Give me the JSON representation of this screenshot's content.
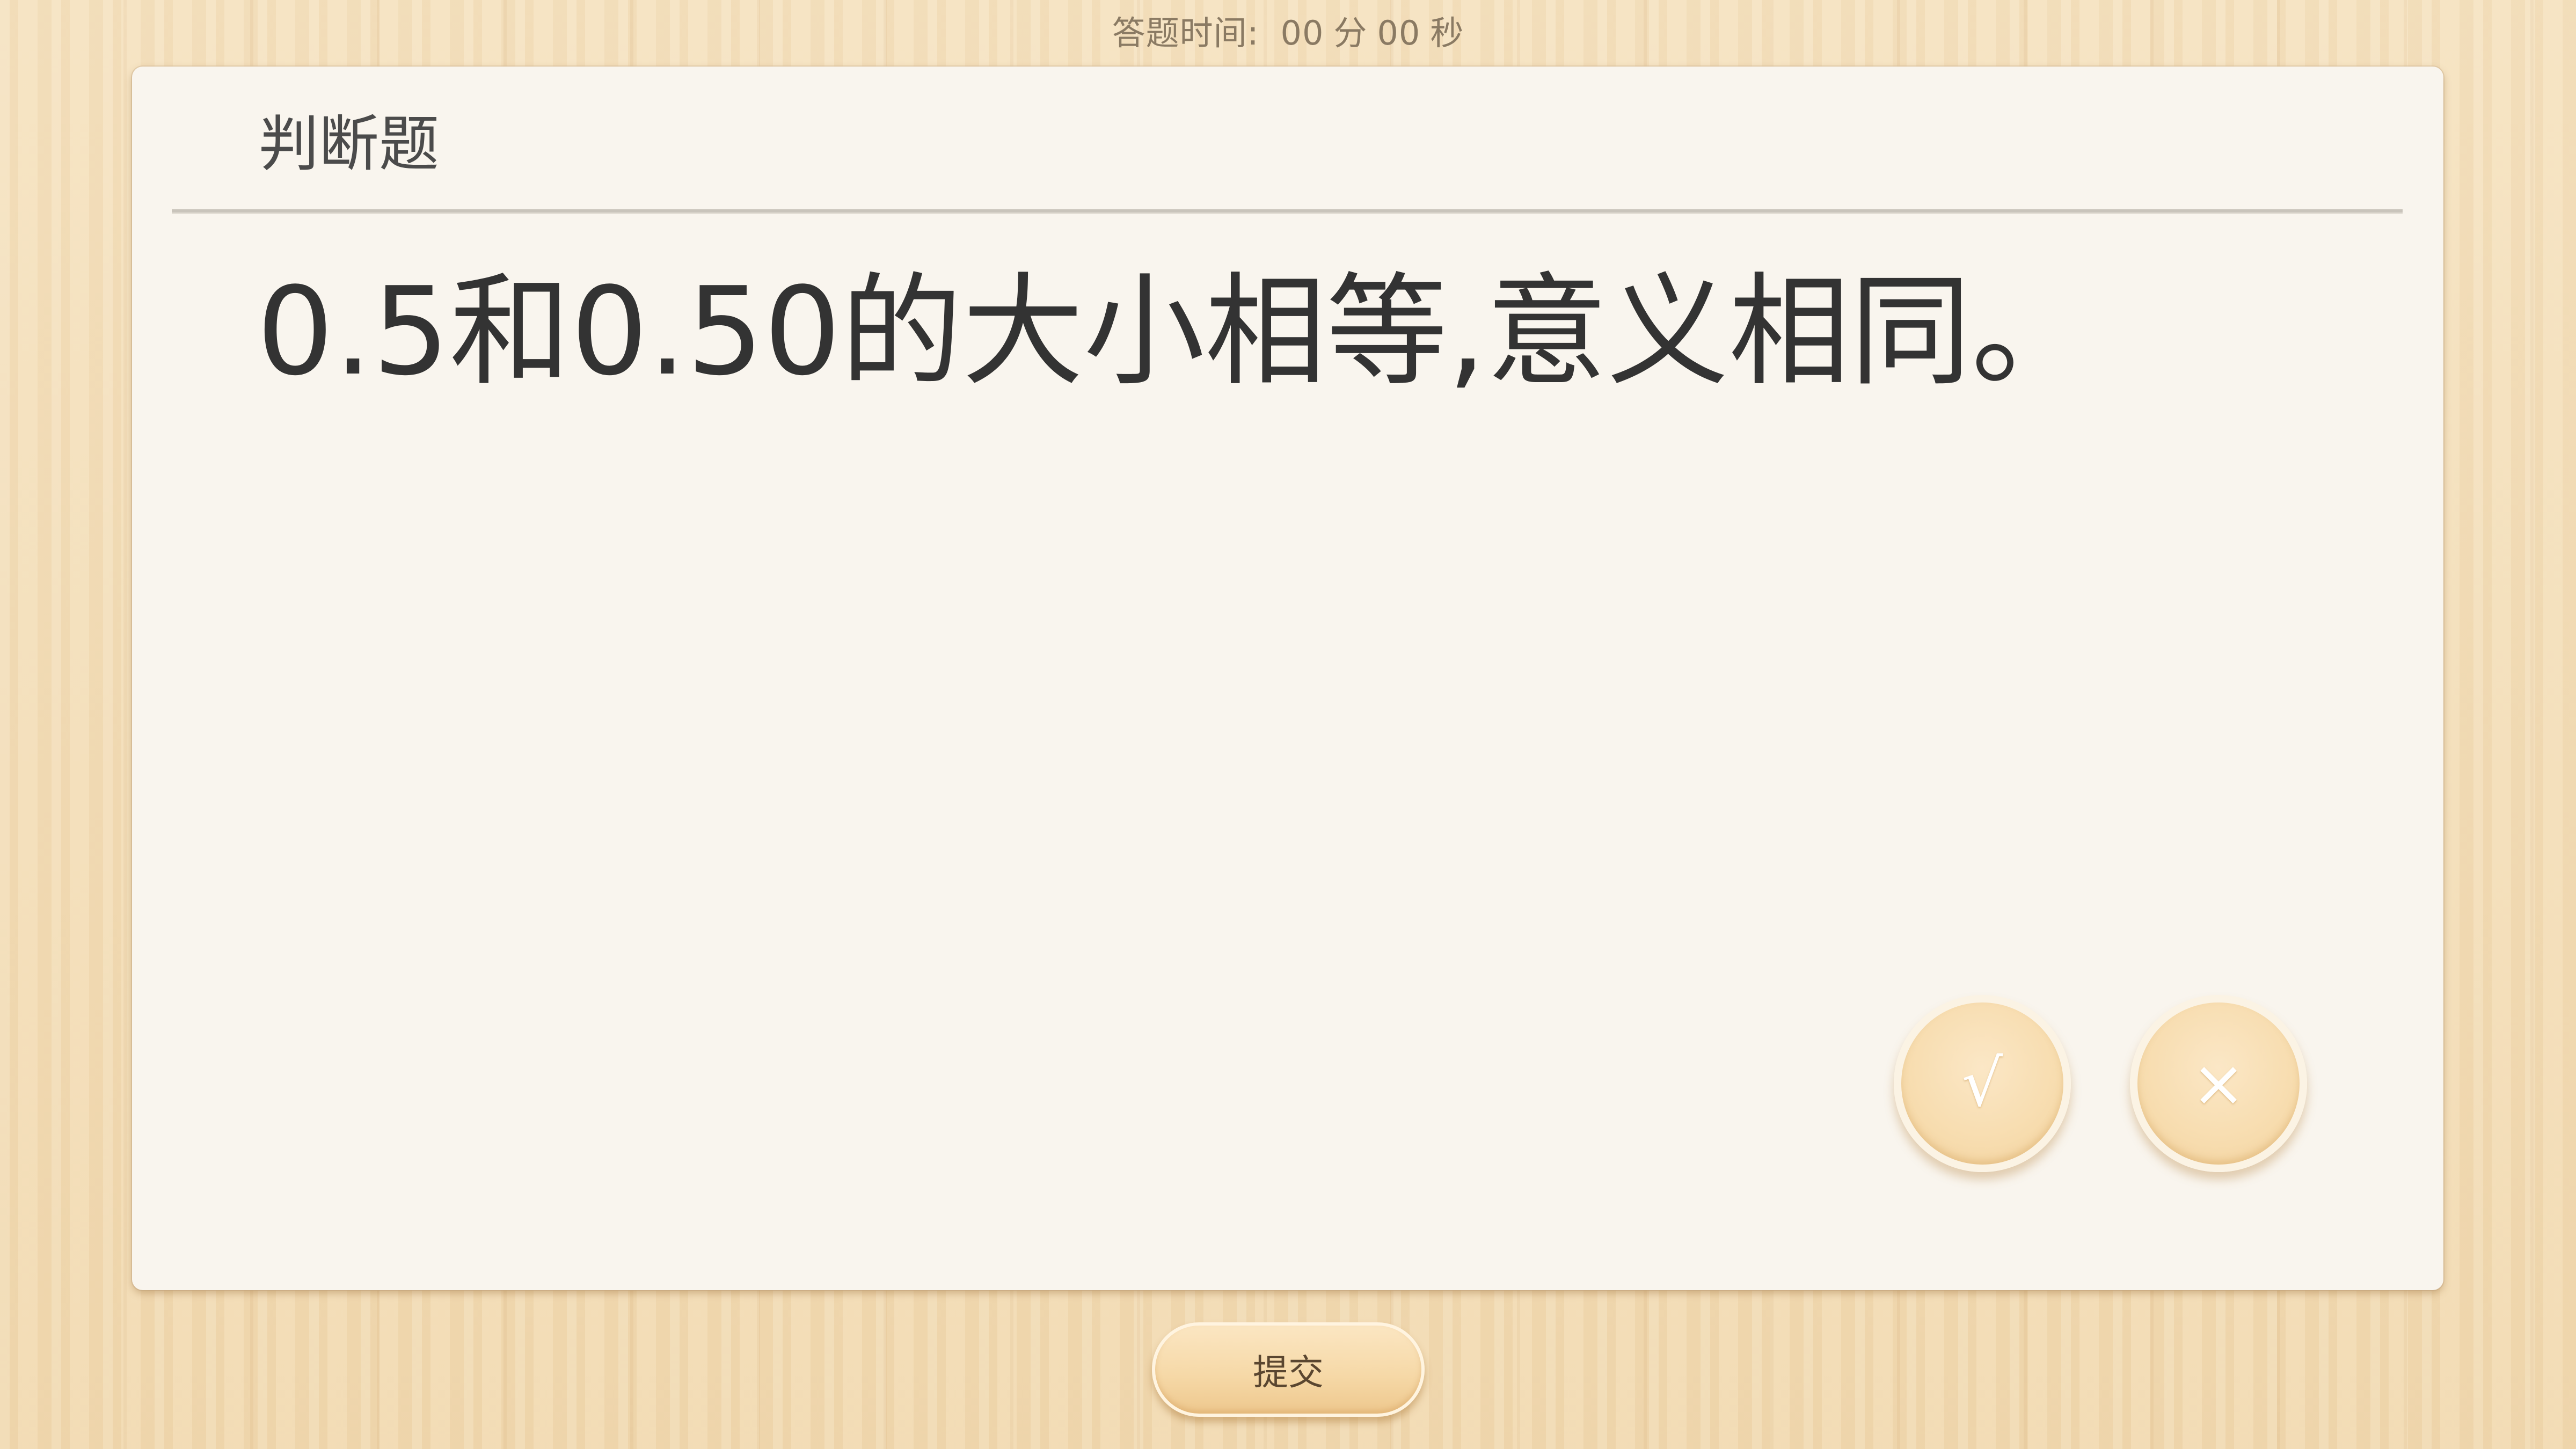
{
  "timer": {
    "label": "答题时间:",
    "minutes": "00",
    "minutes_unit": "分",
    "seconds": "00",
    "seconds_unit": "秒"
  },
  "card": {
    "title": "判断题",
    "question": "0.5和0.50的大小相等,意义相同。"
  },
  "answers": {
    "true_label": "√",
    "false_label": "×"
  },
  "submit": {
    "label": "提交"
  },
  "colors": {
    "background": "#f3dcb5",
    "card": "#f9f5ee",
    "button": "#f7dcae",
    "text": "#333333"
  }
}
